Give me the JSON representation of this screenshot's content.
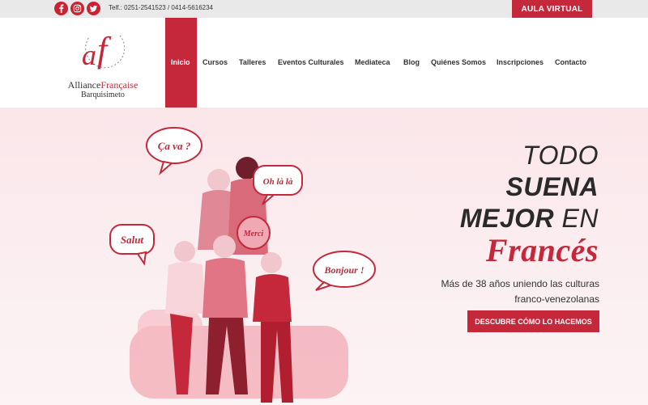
{
  "topbar": {
    "social": [
      {
        "name": "facebook-icon",
        "color": "#c82333"
      },
      {
        "name": "instagram-icon",
        "color": "#c82333"
      },
      {
        "name": "twitter-icon",
        "color": "#c82333"
      }
    ],
    "phone_text": "Telf.:  0251-2541523 / 0414-5616234",
    "aula_label": "AULA VIRTUAL"
  },
  "logo": {
    "mark": "af",
    "name_part1": "Alliance",
    "name_part2": "Française",
    "city": "Barquisimeto"
  },
  "nav": {
    "items": [
      {
        "label": "Inicio",
        "active": true
      },
      {
        "label": "Cursos"
      },
      {
        "label": "Talleres"
      },
      {
        "label": "Eventos Culturales"
      },
      {
        "label": "Mediateca"
      },
      {
        "label": "Blog"
      },
      {
        "label": "Quiénes Somos"
      },
      {
        "label": "Inscripciones"
      },
      {
        "label": "Contacto"
      }
    ]
  },
  "hero": {
    "bubbles": [
      "Ça va ?",
      "Oh là là",
      "Merci",
      "Salut",
      "Bonjour !"
    ],
    "line1": "TODO",
    "line2": "SUENA",
    "line3_bold": "MEJOR",
    "line3_thin": "EN",
    "line4": "Francés",
    "subtitle": "Más de 38 años uniendo las culturas franco-venezolanas",
    "cta_label": "DESCUBRE CÓMO LO HACEMOS"
  },
  "colors": {
    "brand_red": "#c4283a",
    "topbar_bg": "#e9e9e9",
    "hero_bg": "#fbe6ea",
    "text_dark": "#2a2a2a"
  }
}
